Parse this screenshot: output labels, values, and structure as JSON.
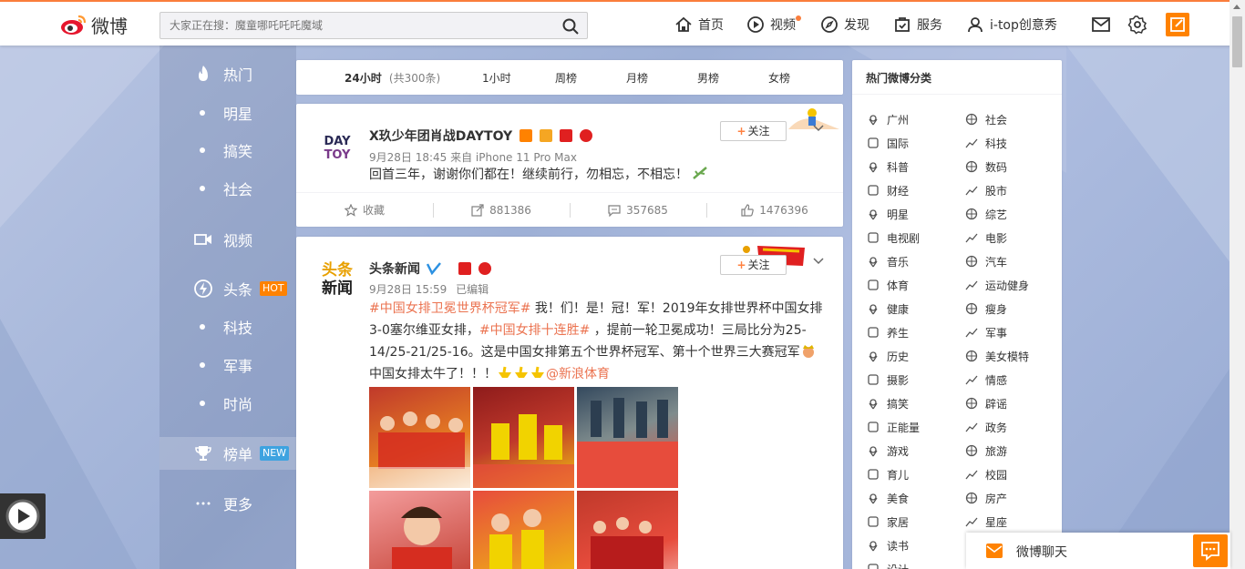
{
  "topbar": {
    "logo_text": "微博",
    "search_placeholder": "大家正在搜：魔童哪吒吒吒魔域",
    "nav": [
      {
        "label": "首页",
        "icon": "home-icon"
      },
      {
        "label": "视频",
        "icon": "video-icon"
      },
      {
        "label": "发现",
        "icon": "compass-icon"
      },
      {
        "label": "服务",
        "icon": "service-icon"
      },
      {
        "label": "i-top创意秀",
        "icon": "user-icon"
      }
    ]
  },
  "leftnav": [
    {
      "label": "热门",
      "type": "main",
      "icon": "fire-icon"
    },
    {
      "label": "明星",
      "type": "sub"
    },
    {
      "label": "搞笑",
      "type": "sub"
    },
    {
      "label": "社会",
      "type": "sub"
    },
    {
      "label": "视频",
      "type": "main",
      "icon": "video-camera-icon"
    },
    {
      "label": "头条",
      "type": "main",
      "icon": "lightning-icon",
      "badge": "HOT",
      "badge_color": "#ff8200"
    },
    {
      "label": "科技",
      "type": "sub"
    },
    {
      "label": "军事",
      "type": "sub"
    },
    {
      "label": "时尚",
      "type": "sub"
    },
    {
      "label": "榜单",
      "type": "main",
      "icon": "trophy-icon",
      "badge": "NEW",
      "badge_color": "#3ea3e0",
      "active": true
    },
    {
      "label": "更多",
      "type": "main",
      "icon": "more-icon"
    }
  ],
  "tabs": [
    {
      "label": "24小时",
      "sub": "(共300条)",
      "active": true
    },
    {
      "label": "1小时"
    },
    {
      "label": "周榜"
    },
    {
      "label": "月榜"
    },
    {
      "label": "男榜"
    },
    {
      "label": "女榜"
    }
  ],
  "posts": [
    {
      "author": "X玖少年团肖战DAYTOY",
      "avatar_text": "DAY TOY",
      "meta": "9月28日 18:45 来自 iPhone 11 Pro Max",
      "text": "回首三年，谢谢你们都在！继续前行，勿相忘，不相忘！",
      "follow_label": "关注",
      "actions": [
        {
          "label": "收藏",
          "icon": "star-icon"
        },
        {
          "label": "881386",
          "icon": "share-icon"
        },
        {
          "label": "357685",
          "icon": "comment-icon"
        },
        {
          "label": "1476396",
          "icon": "like-icon"
        }
      ]
    },
    {
      "author": "头条新闻",
      "avatar_text": "头条新闻",
      "meta_time": "9月28日 15:59",
      "meta_edited": "已编辑",
      "text_parts": [
        {
          "t": "#中国女排卫冕世界杯冠军#",
          "hl": true
        },
        {
          "t": " 我！们！是！冠！军！2019年女排世界杯中国女排3-0塞尔维亚女排，",
          "hl": false
        },
        {
          "t": "#中国女排十连胜#",
          "hl": true
        },
        {
          "t": " ，提前一轮卫冕成功！三局比分为25-14/25-21/25-16。这是中国女排第五个世界杯冠军、第十个世界三大赛冠军",
          "hl": false
        },
        {
          "t": "中国女排太牛了！！！",
          "hl": false
        },
        {
          "t": "@新浪体育",
          "hl": true
        }
      ],
      "follow_label": "关注"
    }
  ],
  "right_panel": {
    "title": "热门微博分类",
    "categories": [
      [
        "广州",
        "社会"
      ],
      [
        "国际",
        "科技"
      ],
      [
        "科普",
        "数码"
      ],
      [
        "财经",
        "股市"
      ],
      [
        "明星",
        "综艺"
      ],
      [
        "电视剧",
        "电影"
      ],
      [
        "音乐",
        "汽车"
      ],
      [
        "体育",
        "运动健身"
      ],
      [
        "健康",
        "瘦身"
      ],
      [
        "养生",
        "军事"
      ],
      [
        "历史",
        "美女模特"
      ],
      [
        "摄影",
        "情感"
      ],
      [
        "搞笑",
        "辟谣"
      ],
      [
        "正能量",
        "政务"
      ],
      [
        "游戏",
        "旅游"
      ],
      [
        "育儿",
        "校园"
      ],
      [
        "美食",
        "房产"
      ],
      [
        "家居",
        "星座"
      ],
      [
        "读书",
        ""
      ],
      [
        "设计",
        ""
      ]
    ]
  },
  "chat": {
    "label": "微博聊天"
  },
  "colors": {
    "accent": "#ff8200",
    "link": "#eb7350",
    "hot": "#ff8200",
    "new": "#3ea3e0"
  }
}
